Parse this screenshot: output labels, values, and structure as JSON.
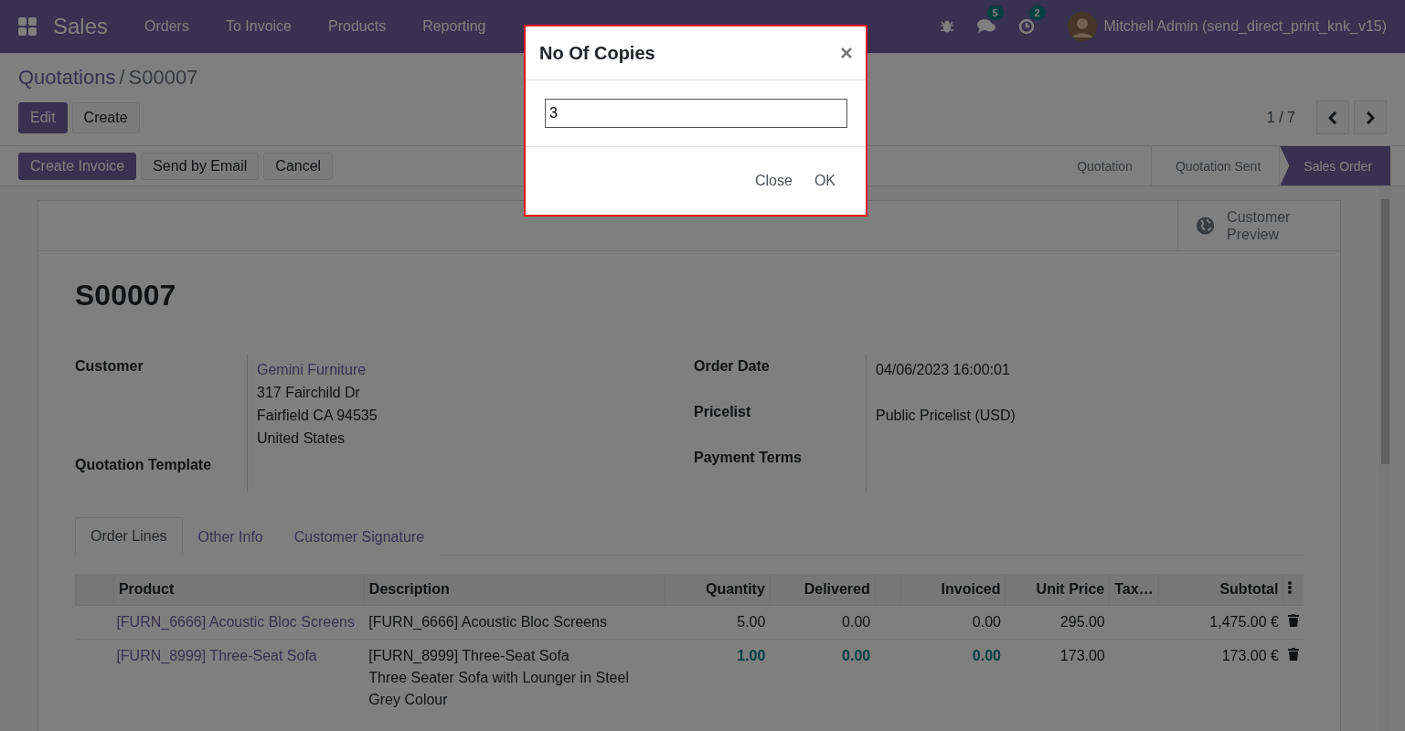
{
  "navbar": {
    "app_name": "Sales",
    "menu": [
      "Orders",
      "To Invoice",
      "Products",
      "Reporting"
    ],
    "messages_count": "5",
    "activities_count": "2",
    "user": "Mitchell Admin (send_direct_print_knk_v15)"
  },
  "breadcrumb": [
    "Quotations",
    "S00007"
  ],
  "breadcrumb_separator": "/",
  "main_buttons": [
    {
      "label": "Edit",
      "primary": true
    },
    {
      "label": "Create",
      "primary": false
    }
  ],
  "pager": "1 / 7",
  "action_buttons": [
    {
      "label": "Create Invoice",
      "primary": true
    },
    {
      "label": "Send by Email",
      "primary": false
    },
    {
      "label": "Cancel",
      "primary": false
    }
  ],
  "stages": [
    {
      "label": "Quotation",
      "selected": false
    },
    {
      "label": "Quotation Sent",
      "selected": false
    },
    {
      "label": "Sales Order",
      "selected": true
    }
  ],
  "smart_button": "Customer Preview",
  "title": "S00007",
  "left_fields": [
    {
      "label": "Customer",
      "link": "Gemini Furniture",
      "lines": [
        "317 Fairchild Dr",
        "Fairfield CA 94535",
        "United States"
      ]
    },
    {
      "label": "Quotation Template"
    }
  ],
  "right_fields": [
    {
      "label": "Order Date",
      "value": "04/06/2023 16:00:01"
    },
    {
      "label": "Pricelist",
      "value": "Public Pricelist (USD)"
    },
    {
      "label": "Payment Terms"
    }
  ],
  "tabs": [
    {
      "label": "Order Lines",
      "selected": true
    },
    {
      "label": "Other Info",
      "selected": false
    },
    {
      "label": "Customer Signature",
      "selected": false
    }
  ],
  "table": {
    "columns": [
      "Product",
      "Description",
      "Quantity",
      "Delivered",
      "Invoiced",
      "Unit Price",
      "Tax…",
      "Subtotal"
    ],
    "rows": [
      {
        "product": "[FURN_6666] Acoustic Bloc Screens",
        "description": [
          "[FURN_6666] Acoustic Bloc Screens"
        ],
        "quantity": "5.00",
        "delivered": "0.00",
        "invoiced": "0.00",
        "unit_price": "295.00",
        "subtotal": "1,475.00 €",
        "emphasized": false
      },
      {
        "product": "[FURN_8999] Three-Seat Sofa",
        "description": [
          "[FURN_8999] Three-Seat Sofa",
          "Three Seater Sofa with Lounger in Steel",
          "Grey Colour"
        ],
        "quantity": "1.00",
        "delivered": "0.00",
        "invoiced": "0.00",
        "unit_price": "173.00",
        "subtotal": "173.00 €",
        "emphasized": true
      }
    ]
  },
  "dialog": {
    "title": "No Of Copies",
    "value": "3",
    "buttons": [
      "Close",
      "OK"
    ]
  }
}
